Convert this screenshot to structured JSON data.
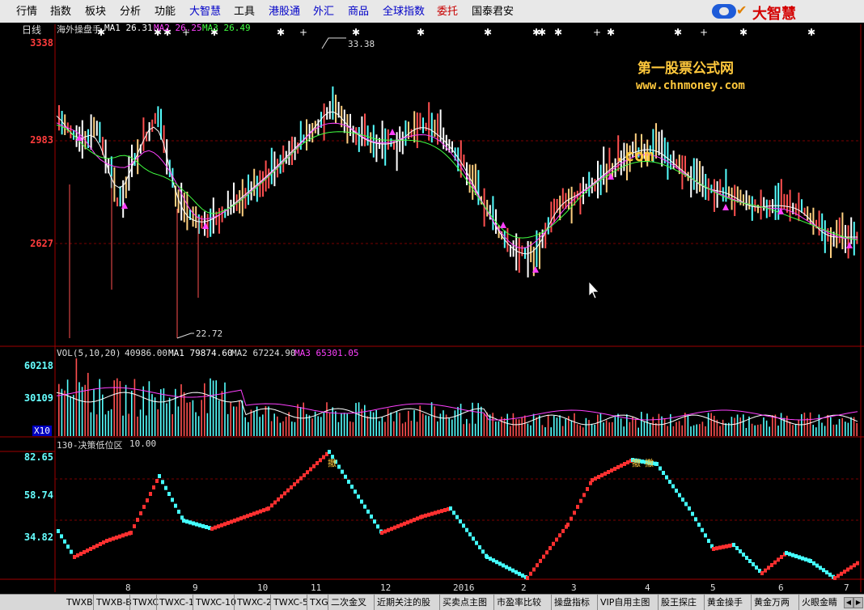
{
  "menu": [
    {
      "label": "行情",
      "color": "normal"
    },
    {
      "label": "指数",
      "color": "normal"
    },
    {
      "label": "板块",
      "color": "normal"
    },
    {
      "label": "分析",
      "color": "normal"
    },
    {
      "label": "功能",
      "color": "normal"
    },
    {
      "label": "大智慧",
      "color": "blue"
    },
    {
      "label": "工具",
      "color": "normal"
    },
    {
      "label": "港股通",
      "color": "blue"
    },
    {
      "label": "外汇",
      "color": "blue"
    },
    {
      "label": "商品",
      "color": "blue"
    },
    {
      "label": "全球指数",
      "color": "blue"
    },
    {
      "label": "委托",
      "color": "red"
    },
    {
      "label": "国泰君安",
      "color": "normal"
    }
  ],
  "brand": {
    "name": "大智慧"
  },
  "main_panel": {
    "period_label": "日线",
    "indicator_name": "海外操盘手",
    "ma1": "MA1 26.31",
    "ma2": "MA2 26.25",
    "ma3": "MA3 26.49",
    "y_ticks": [
      "3338",
      "2983",
      "2627"
    ],
    "high_label": "33.38",
    "low_label": "22.72",
    "watermark_cn": "第一股票公式网",
    "watermark_url": "www.chnmoney.com",
    "watermark_com": ".com"
  },
  "volume_panel": {
    "title": "VOL(5,10,20)",
    "vol": "40986.00",
    "ma1": "MA1 79874.60",
    "ma2": "MA2 67224.90",
    "ma3": "MA3 65301.05",
    "y_ticks": [
      "60218",
      "30109"
    ],
    "multiplier": "X10"
  },
  "oscillator_panel": {
    "title": "130-决策低位区",
    "value": "10.00",
    "y_ticks": [
      "82.65",
      "58.74",
      "34.82"
    ],
    "signal_labels": [
      "撤",
      "撤",
      "撤"
    ]
  },
  "x_axis": [
    "8",
    "9",
    "10",
    "11",
    "12",
    "2016",
    "2",
    "3",
    "4",
    "5",
    "6",
    "7"
  ],
  "bottom_tabs": [
    "TWXB",
    "TWXB-B",
    "TWXC",
    "TWXC-1",
    "TWXC-10",
    "TWXC-2",
    "TWXC-5",
    "TXG",
    "二次金叉",
    "近期关注的股",
    "买卖点主图",
    "市盈率比较",
    "操盘指标",
    "VIP自用主图",
    "股王探庄",
    "黄金操手",
    "黄金万两",
    "火眼金睛"
  ],
  "colors": {
    "up": "#ff3c3c",
    "down": "#5ff",
    "ma1": "#ffffff",
    "ma2": "#ff40ff",
    "ma3": "#40ff40",
    "accent": "#ffc83c"
  }
}
